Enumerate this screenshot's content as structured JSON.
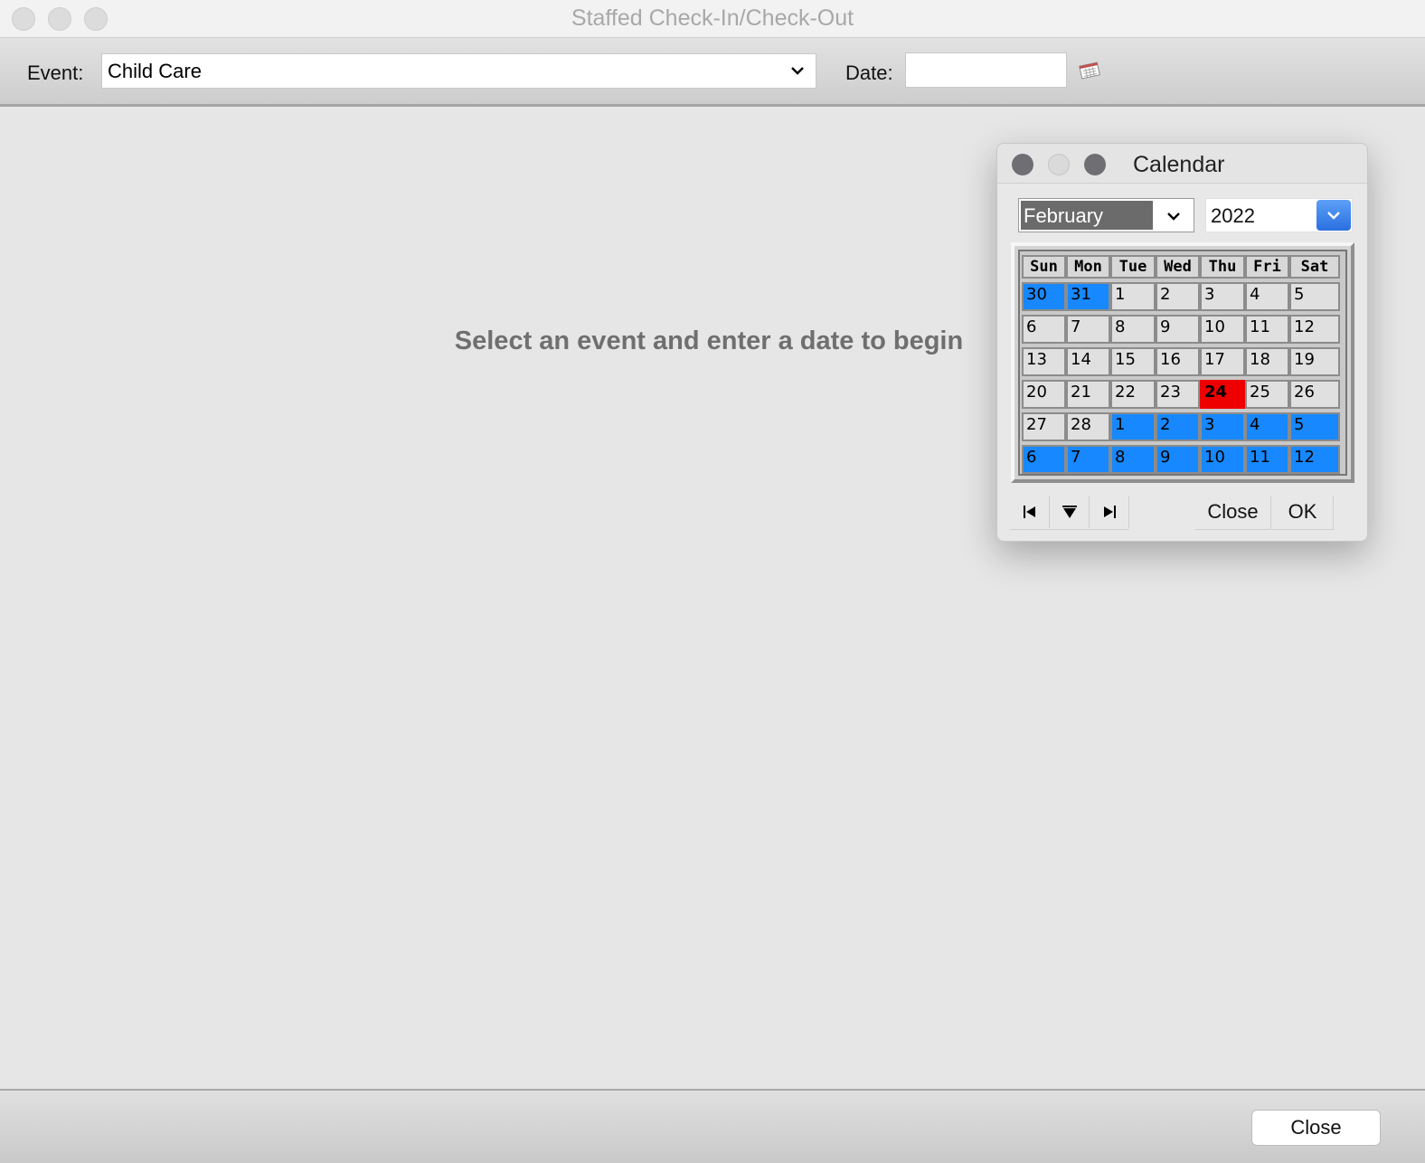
{
  "window": {
    "title": "Staffed Check-In/Check-Out"
  },
  "toolbar": {
    "event_label": "Event:",
    "event_value": "Child Care",
    "date_label": "Date:",
    "date_value": ""
  },
  "main": {
    "message": "Select an event and enter a date to begin"
  },
  "footer": {
    "close_label": "Close"
  },
  "calendar": {
    "title": "Calendar",
    "month": "February",
    "year": "2022",
    "day_headers": [
      "Sun",
      "Mon",
      "Tue",
      "Wed",
      "Thu",
      "Fri",
      "Sat"
    ],
    "weeks": [
      [
        "30",
        "31",
        "1",
        "2",
        "3",
        "4",
        "5"
      ],
      [
        "6",
        "7",
        "8",
        "9",
        "10",
        "11",
        "12"
      ],
      [
        "13",
        "14",
        "15",
        "16",
        "17",
        "18",
        "19"
      ],
      [
        "20",
        "21",
        "22",
        "23",
        "24",
        "25",
        "26"
      ],
      [
        "27",
        "28",
        "1",
        "2",
        "3",
        "4",
        "5"
      ],
      [
        "6",
        "7",
        "8",
        "9",
        "10",
        "11",
        "12"
      ]
    ],
    "today": "24",
    "close_label": "Close",
    "ok_label": "OK",
    "colors": {
      "other_month": "#1788ff",
      "today": "#ef0000",
      "accent": "#2a6fe0"
    }
  }
}
